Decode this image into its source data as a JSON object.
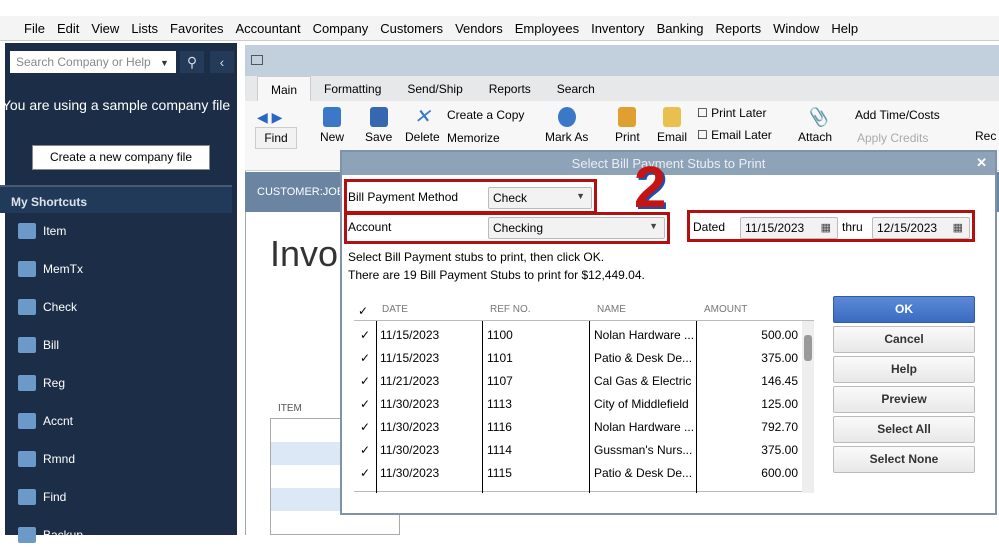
{
  "menu": [
    "File",
    "Edit",
    "View",
    "Lists",
    "Favorites",
    "Accountant",
    "Company",
    "Customers",
    "Vendors",
    "Employees",
    "Inventory",
    "Banking",
    "Reports",
    "Window",
    "Help"
  ],
  "sidebar": {
    "search_placeholder": "Search Company or Help",
    "sample_text": "You are using a sample company file",
    "create_button": "Create a new company file",
    "shortcuts_header": "My Shortcuts",
    "items": [
      "Item",
      "MemTx",
      "Check",
      "Bill",
      "Reg",
      "Accnt",
      "Rmnd",
      "Find",
      "Backup"
    ]
  },
  "ribbon": {
    "tabs": [
      "Main",
      "Formatting",
      "Send/Ship",
      "Reports",
      "Search"
    ],
    "find": "Find",
    "new": "New",
    "save": "Save",
    "delete": "Delete",
    "create_copy": "Create a Copy",
    "memorize": "Memorize",
    "mark_as": "Mark As",
    "print": "Print",
    "email": "Email",
    "print_later": "Print Later",
    "email_later": "Email Later",
    "attach": "Attach",
    "add_time": "Add Time/Costs",
    "apply_credits": "Apply Credits",
    "rec": "Rec"
  },
  "invoice": {
    "customer_job": "CUSTOMER:JOB",
    "title": "Invo",
    "item_header": "ITEM"
  },
  "dialog": {
    "title": "Select Bill Payment Stubs to Print",
    "annotation": "2",
    "method_label": "Bill Payment Method",
    "method_value": "Check",
    "account_label": "Account",
    "account_value": "Checking",
    "dated_label": "Dated",
    "date_from": "11/15/2023",
    "thru_label": "thru",
    "date_to": "12/15/2023",
    "instruction": "Select Bill Payment stubs to print, then click OK.",
    "summary": "There are 19 Bill Payment Stubs to print for $12,449.04.",
    "columns": [
      "✓",
      "DATE",
      "REF NO.",
      "NAME",
      "AMOUNT"
    ],
    "rows": [
      {
        "check": "✓",
        "date": "11/15/2023",
        "ref": "1100",
        "name": "Nolan Hardware ...",
        "amount": "500.00"
      },
      {
        "check": "✓",
        "date": "11/15/2023",
        "ref": "1101",
        "name": "Patio & Desk De...",
        "amount": "375.00"
      },
      {
        "check": "✓",
        "date": "11/21/2023",
        "ref": "1107",
        "name": "Cal Gas & Electric",
        "amount": "146.45"
      },
      {
        "check": "✓",
        "date": "11/30/2023",
        "ref": "1113",
        "name": "City of Middlefield",
        "amount": "125.00"
      },
      {
        "check": "✓",
        "date": "11/30/2023",
        "ref": "1116",
        "name": "Nolan Hardware ...",
        "amount": "792.70"
      },
      {
        "check": "✓",
        "date": "11/30/2023",
        "ref": "1114",
        "name": "Gussman's Nurs...",
        "amount": "375.00"
      },
      {
        "check": "✓",
        "date": "11/30/2023",
        "ref": "1115",
        "name": "Patio & Desk De...",
        "amount": "600.00"
      }
    ],
    "buttons": [
      "OK",
      "Cancel",
      "Help",
      "Preview",
      "Select All",
      "Select None"
    ]
  }
}
